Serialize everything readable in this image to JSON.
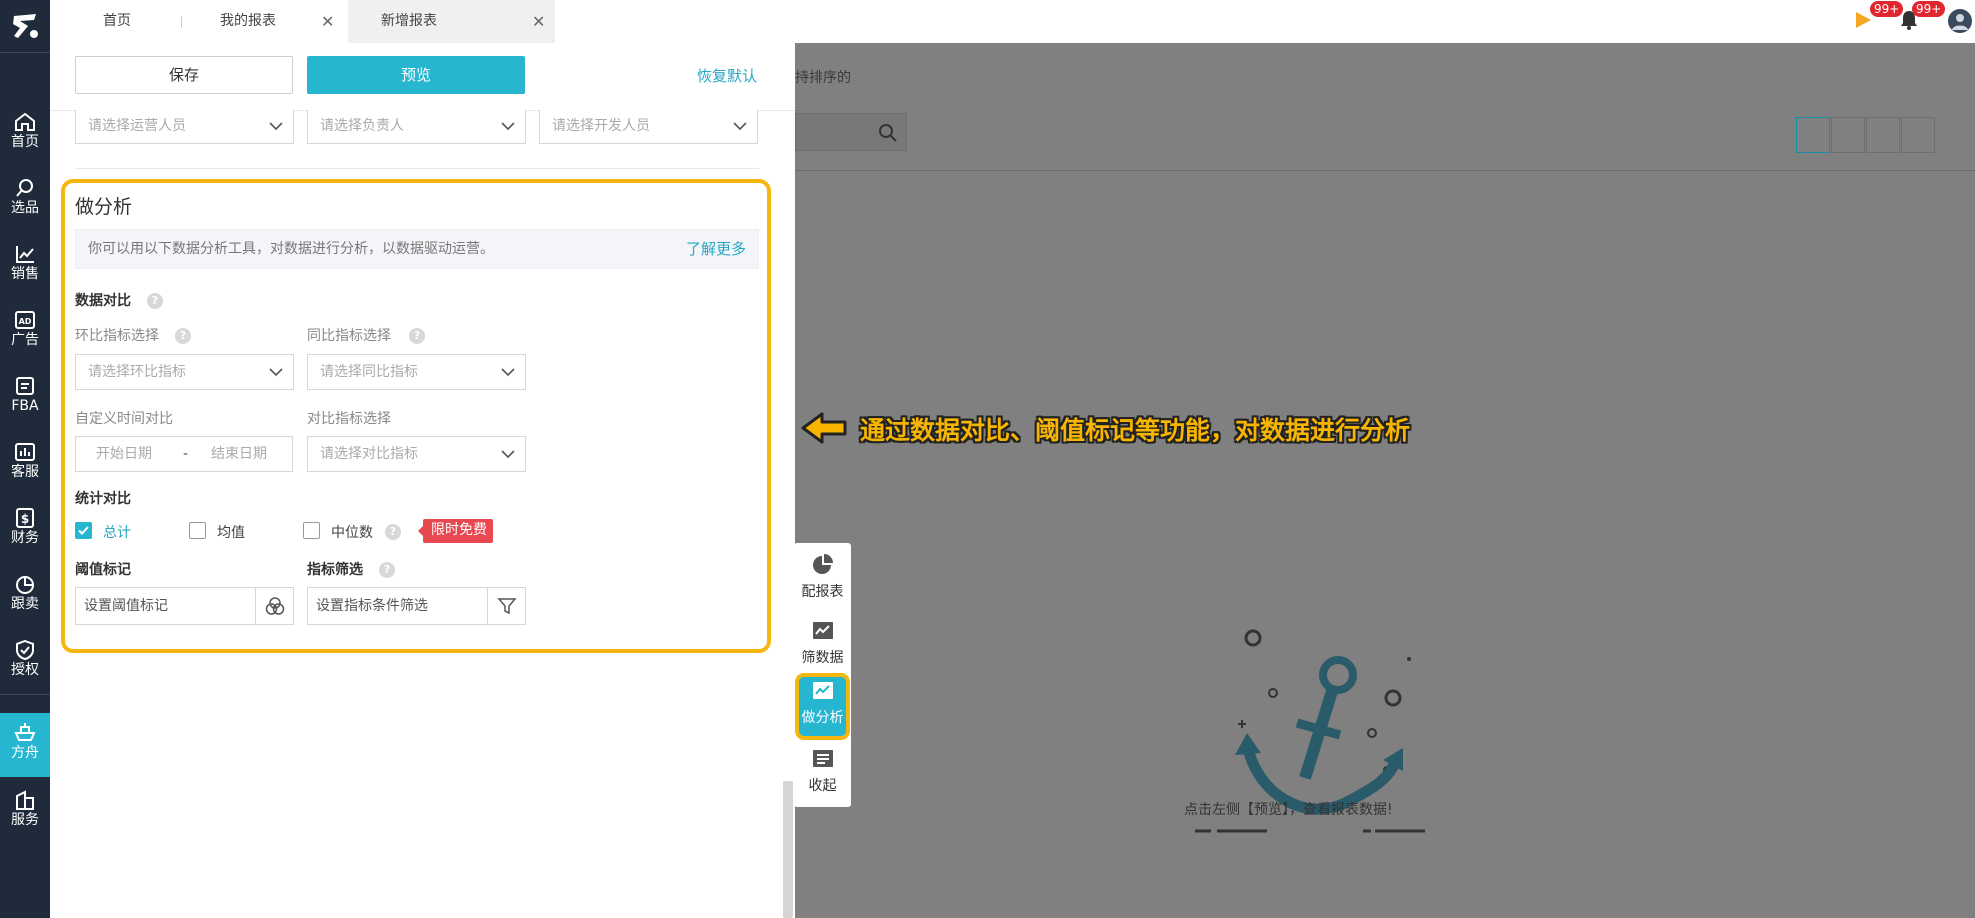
{
  "tabs": [
    {
      "label": "首页",
      "closable": false
    },
    {
      "label": "我的报表",
      "closable": true
    },
    {
      "label": "新增报表",
      "closable": true,
      "active": true
    }
  ],
  "notifications": {
    "play_badge": "99+",
    "bell_badge": "99+"
  },
  "sidebar": {
    "items": [
      {
        "label": "首页",
        "icon": "home-icon"
      },
      {
        "label": "选品",
        "icon": "search-icon"
      },
      {
        "label": "销售",
        "icon": "trend-icon"
      },
      {
        "label": "广告",
        "icon": "ad-icon"
      },
      {
        "label": "FBA",
        "icon": "fba-icon"
      },
      {
        "label": "客服",
        "icon": "chart-bar-icon"
      },
      {
        "label": "财务",
        "icon": "dollar-icon"
      },
      {
        "label": "跟卖",
        "icon": "pie-icon"
      },
      {
        "label": "授权",
        "icon": "shield-icon"
      },
      {
        "label": "方舟",
        "icon": "ark-icon",
        "active": true
      },
      {
        "label": "服务",
        "icon": "building-icon"
      }
    ]
  },
  "panel": {
    "save_label": "保存",
    "preview_label": "预览",
    "reset_label": "恢复默认",
    "ops_placeholder": "请选择运营人员",
    "owner_placeholder": "请选择负责人",
    "dev_placeholder": "请选择开发人员",
    "analysis": {
      "title": "做分析",
      "info": "你可以用以下数据分析工具，对数据进行分析，以数据驱动运营。",
      "learn_more": "了解更多",
      "data_compare_label": "数据对比",
      "mom_label": "环比指标选择",
      "mom_placeholder": "请选择环比指标",
      "yoy_label": "同比指标选择",
      "yoy_placeholder": "请选择同比指标",
      "custom_time_label": "自定义时间对比",
      "start_placeholder": "开始日期",
      "range_sep": "-",
      "end_placeholder": "结束日期",
      "compare_metric_label": "对比指标选择",
      "compare_metric_placeholder": "请选择对比指标",
      "stat_compare_label": "统计对比",
      "stat_total": "总计",
      "stat_total_checked": true,
      "stat_avg": "均值",
      "stat_median": "中位数",
      "free_tag": "限时免费",
      "threshold_label": "阈值标记",
      "threshold_placeholder": "设置阈值标记",
      "filter_label": "指标筛选",
      "filter_placeholder": "设置指标条件筛选"
    }
  },
  "background": {
    "sort_hint": "持排序的",
    "empty_text": "点击左侧【预览】，查看报表数据!"
  },
  "annotation": "通过数据对比、阈值标记等功能，对数据进行分析",
  "float_toolbar": [
    {
      "label": "配报表",
      "icon": "pie-chart-icon"
    },
    {
      "label": "筛数据",
      "icon": "line-chart-icon"
    },
    {
      "label": "做分析",
      "icon": "analysis-icon",
      "active": true
    },
    {
      "label": "收起",
      "icon": "collapse-icon"
    }
  ],
  "colors": {
    "accent": "#27b6d0",
    "highlight": "#f5b60d",
    "sidebar": "#1f2b3a",
    "tag_red": "#e8484f"
  }
}
